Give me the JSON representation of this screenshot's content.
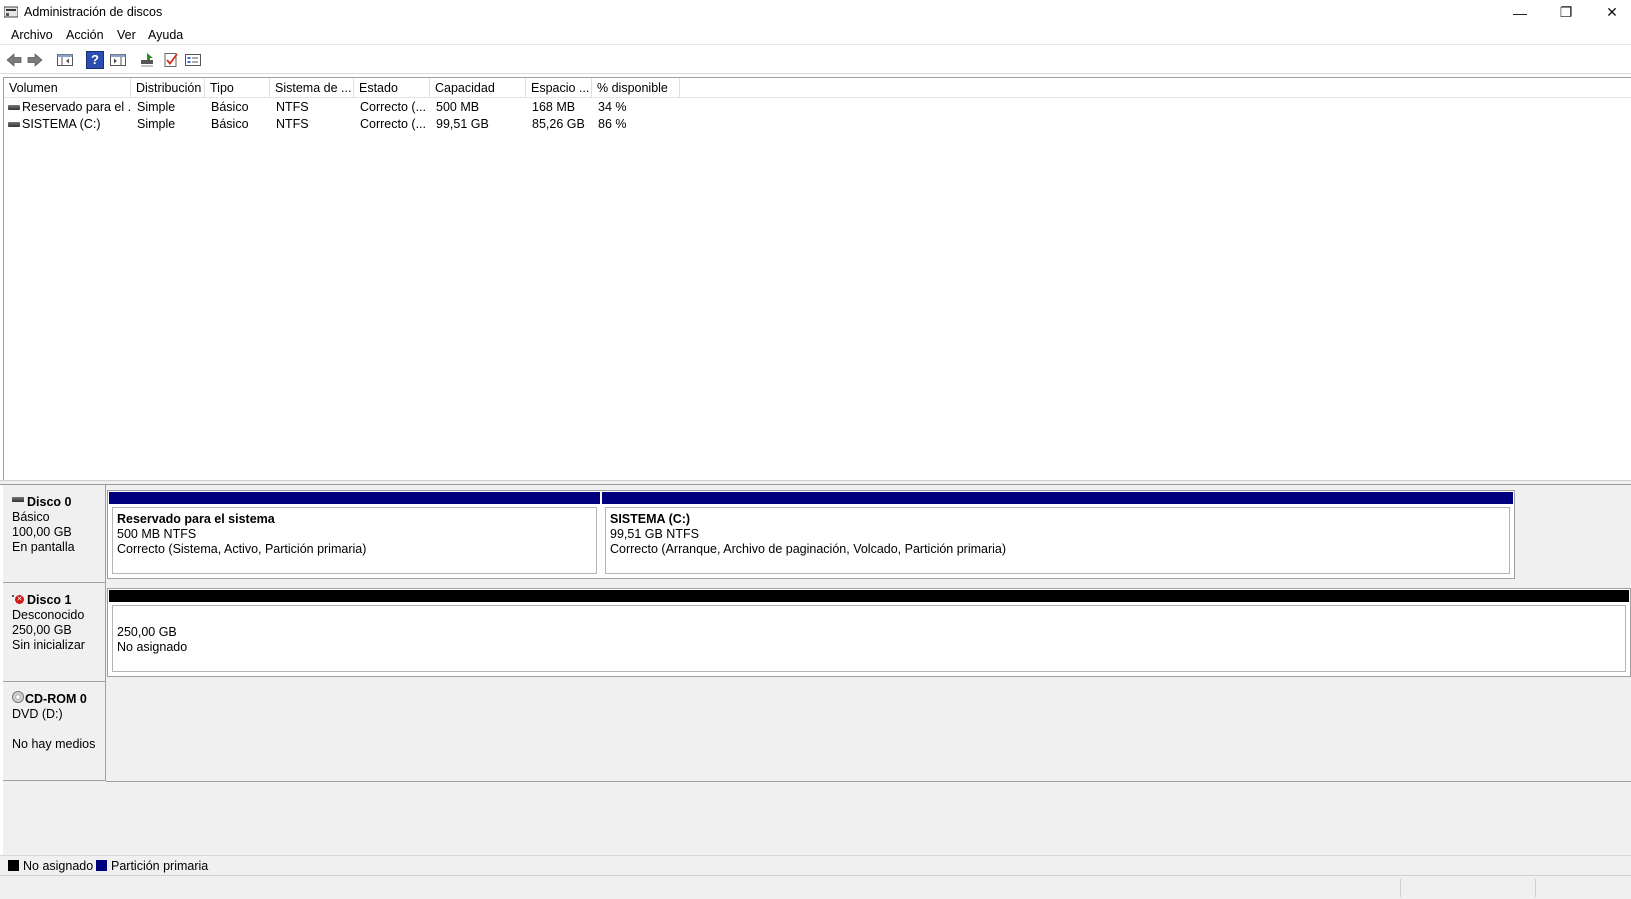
{
  "window": {
    "title": "Administración de discos",
    "min_glyph": "—",
    "max_glyph": "❐",
    "close_glyph": "✕"
  },
  "menu": [
    "Archivo",
    "Acción",
    "Ver",
    "Ayuda"
  ],
  "toolbar": {
    "icons": [
      "back-arrow-icon",
      "forward-arrow-icon",
      "show-hide-console-tree-icon",
      "help-icon",
      "show-hide-action-pane-icon",
      "connect-disk-icon",
      "check-properties-icon",
      "properties-view-icon"
    ],
    "help_glyph": "?"
  },
  "volume_list": {
    "columns": [
      "Volumen",
      "Distribución",
      "Tipo",
      "Sistema de ...",
      "Estado",
      "Capacidad",
      "Espacio ...",
      "% disponible"
    ],
    "rows": [
      [
        "Reservado para el ...",
        "Simple",
        "Básico",
        "NTFS",
        "Correcto (...",
        "500 MB",
        "168 MB",
        "34 %"
      ],
      [
        "SISTEMA (C:)",
        "Simple",
        "Básico",
        "NTFS",
        "Correcto (...",
        "99,51 GB",
        "85,26 GB",
        "86 %"
      ]
    ]
  },
  "disks": {
    "disk0": {
      "name": "Disco 0",
      "type": "Básico",
      "size": "100,00 GB",
      "status": "En pantalla",
      "partitions": [
        {
          "name": "Reservado para el sistema",
          "size_fs": "500 MB NTFS",
          "status": "Correcto (Sistema, Activo, Partición primaria)"
        },
        {
          "name": "SISTEMA  (C:)",
          "size_fs": "99,51 GB NTFS",
          "status": "Correcto (Arranque, Archivo de paginación, Volcado, Partición primaria)"
        }
      ]
    },
    "disk1": {
      "name": "Disco 1",
      "type": "Desconocido",
      "size": "250,00 GB",
      "status": "Sin inicializar",
      "error_glyph": "✕",
      "unallocated": {
        "size": "250,00 GB",
        "label": "No asignado"
      }
    },
    "cdrom0": {
      "name": "CD-ROM 0",
      "type": "DVD (D:)",
      "status": "No hay medios"
    }
  },
  "legend": [
    {
      "label": "No asignado",
      "color": "#000000"
    },
    {
      "label": "Partición primaria",
      "color": "#00007f"
    }
  ],
  "colors": {
    "primary_partition": "#00007f",
    "unallocated": "#000000"
  }
}
